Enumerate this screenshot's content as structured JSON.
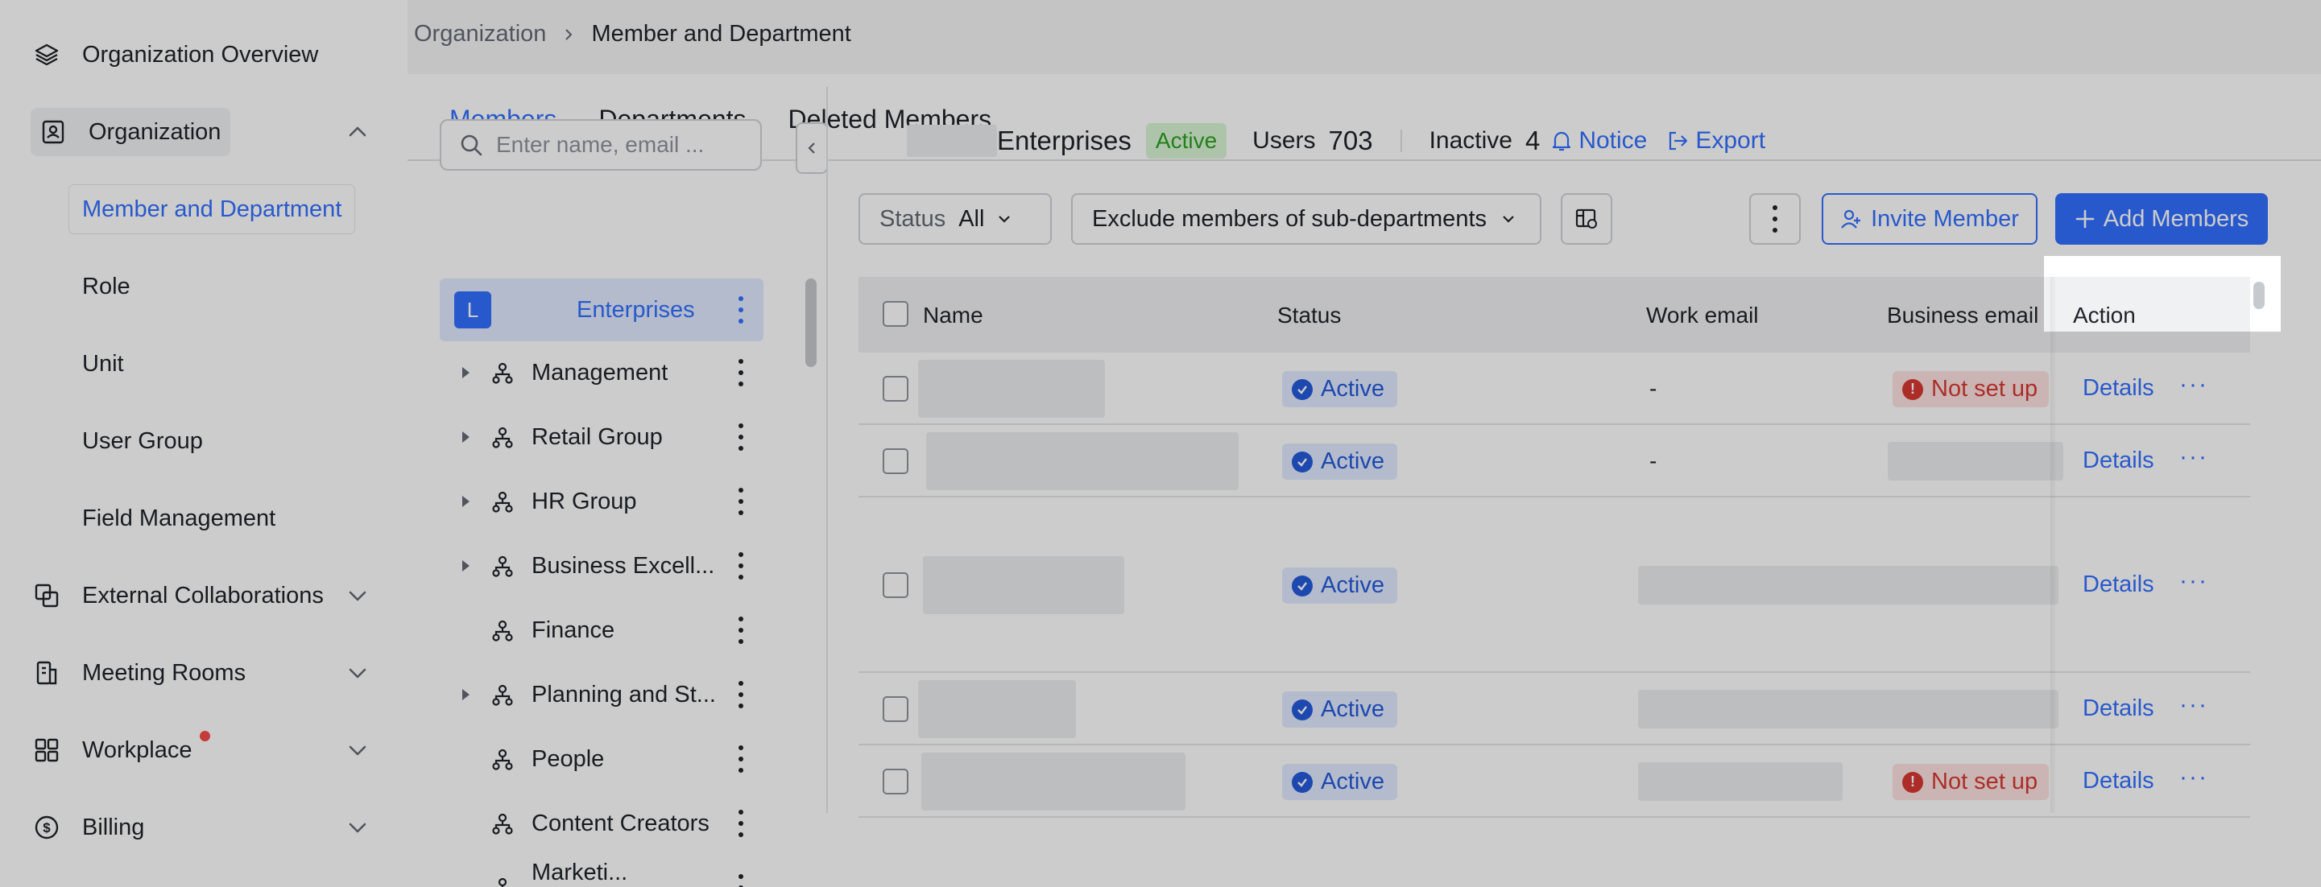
{
  "sidebar": {
    "items": [
      {
        "label": "Organization Overview",
        "icon": "layers-icon"
      },
      {
        "label": "Organization",
        "icon": "contact-card-icon",
        "expanded": true
      },
      {
        "label": "External Collaborations",
        "icon": "external-link-icon"
      },
      {
        "label": "Meeting Rooms",
        "icon": "building-icon"
      },
      {
        "label": "Workplace",
        "icon": "grid-icon",
        "notification_dot": true
      },
      {
        "label": "Billing",
        "icon": "dollar-circle-icon"
      }
    ],
    "organization_sub": [
      {
        "label": "Member and Department",
        "active": true
      },
      {
        "label": "Role"
      },
      {
        "label": "Unit"
      },
      {
        "label": "User Group"
      },
      {
        "label": "Field Management"
      }
    ]
  },
  "breadcrumb": {
    "parent": "Organization",
    "current": "Member and Department"
  },
  "tabs": [
    {
      "label": "Members",
      "active": true
    },
    {
      "label": "Departments"
    },
    {
      "label": "Deleted Members"
    }
  ],
  "tree": {
    "search_placeholder": "Enter name, email ...",
    "root": {
      "avatar": "L",
      "label": "Enterprises"
    },
    "departments": [
      {
        "label": "Management",
        "has_children": true
      },
      {
        "label": "Retail Group",
        "has_children": true
      },
      {
        "label": "HR Group",
        "has_children": true
      },
      {
        "label": "Business Excell...",
        "has_children": true
      },
      {
        "label": "Finance",
        "has_children": false
      },
      {
        "label": "Planning and St...",
        "has_children": true
      },
      {
        "label": "People",
        "has_children": false
      },
      {
        "label": "Content Creators",
        "has_children": false
      },
      {
        "label": "Marketi...",
        "has_children": false
      }
    ]
  },
  "summary": {
    "org_name": "Enterprises",
    "status_badge": "Active",
    "users_label": "Users",
    "users_count": "703",
    "inactive_label": "Inactive",
    "inactive_count": "4",
    "notice_label": "Notice",
    "export_label": "Export"
  },
  "filters": {
    "status_label": "Status",
    "status_value": "All",
    "scope_value": "Exclude members of sub-departments"
  },
  "actions": {
    "invite_label": "Invite Member",
    "add_label": "Add Members"
  },
  "table": {
    "columns": [
      "Name",
      "Status",
      "Work email",
      "Business email",
      "Action"
    ],
    "rows": [
      {
        "status": "Active",
        "work_email": "-",
        "business_email": "Not set up",
        "action": "Details",
        "more": "···"
      },
      {
        "status": "Active",
        "work_email": "-",
        "business_email": "",
        "action": "Details",
        "more": "···"
      },
      {
        "status": "Active",
        "work_email": "",
        "business_email": "",
        "action": "Details",
        "more": "···"
      },
      {
        "status": "Active",
        "work_email": "",
        "business_email": "",
        "action": "Details",
        "more": "···"
      },
      {
        "status": "Active",
        "work_email": "",
        "business_email": "Not set up",
        "action": "Details",
        "more": "···"
      }
    ]
  },
  "colors": {
    "accent": "#3370ff",
    "active_green": "#2ea121",
    "danger": "#d83931"
  }
}
